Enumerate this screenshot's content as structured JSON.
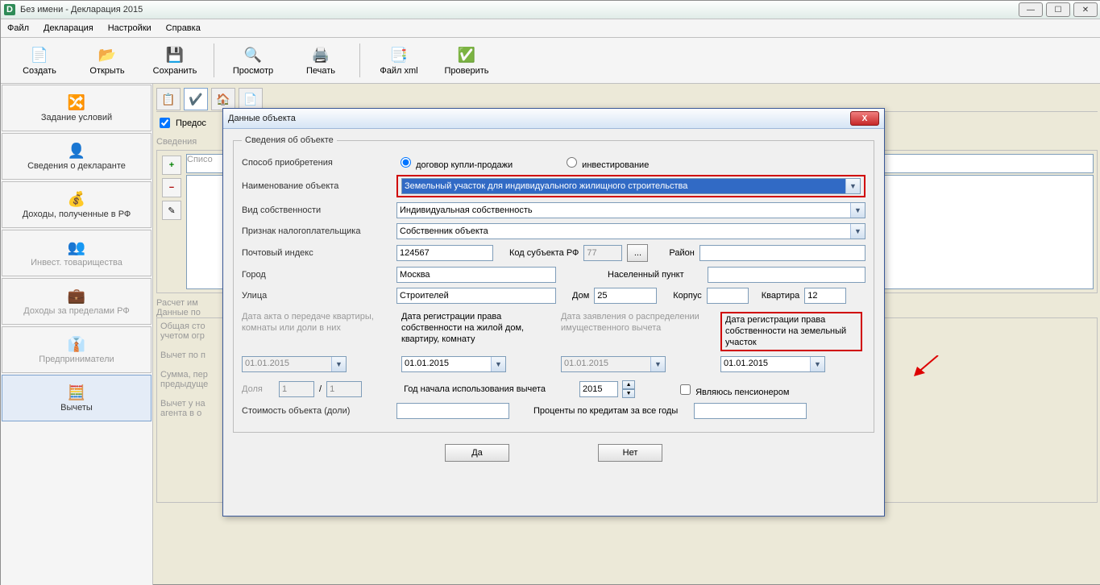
{
  "window": {
    "title": "Без имени - Декларация 2015"
  },
  "menu": {
    "file": "Файл",
    "declaration": "Декларация",
    "settings": "Настройки",
    "help": "Справка"
  },
  "toolbar": {
    "create": "Создать",
    "open": "Открыть",
    "save": "Сохранить",
    "preview": "Просмотр",
    "print": "Печать",
    "xml": "Файл xml",
    "check": "Проверить"
  },
  "sidebar": {
    "conditions": "Задание условий",
    "declarant": "Сведения о декларанте",
    "income_rf": "Доходы, полученные в РФ",
    "invest": "Инвест. товарищества",
    "income_abroad": "Доходы за пределами РФ",
    "entrepreneurs": "Предприниматели",
    "deductions": "Вычеты"
  },
  "mainbg": {
    "checkbox": "Предос",
    "heading": "Сведения",
    "list_btn": "Списо",
    "calc1": "Расчет им",
    "calc2": "Данные по",
    "line1": "Общая сто",
    "line2": "учетом огр",
    "line3": "Вычет по п",
    "line4": "Сумма, пер",
    "line5": "предыдуще",
    "line6": "Вычет у на",
    "line7": "агента в о"
  },
  "dialog": {
    "title": "Данные объекта",
    "legend": "Сведения об объекте",
    "labels": {
      "acq_method": "Способ приобретения",
      "radio_buy": "договор купли-продажи",
      "radio_invest": "инвестирование",
      "object_name": "Наименование объекта",
      "ownership": "Вид собственности",
      "taxpayer": "Признак налогоплательщика",
      "postcode": "Почтовый индекс",
      "region_code": "Код субъекта РФ",
      "district": "Район",
      "city": "Город",
      "settlement": "Населенный пункт",
      "street": "Улица",
      "house": "Дом",
      "building": "Корпус",
      "flat": "Квартира",
      "date_act": "Дата акта о передаче квартиры, комнаты или доли в них",
      "date_reg_house": "Дата регистрации права собственности на жилой дом, квартиру, комнату",
      "date_statement": "Дата заявления о распределении имущественного вычета",
      "date_reg_land": "Дата регистрации права собственности на земельный участок",
      "share": "Доля",
      "year_start": "Год начала использования вычета",
      "pensioner": "Являюсь пенсионером",
      "cost": "Стоимость объекта (доли)",
      "interest": "Проценты по кредитам за все годы",
      "ok": "Да",
      "cancel": "Нет"
    },
    "values": {
      "object_name": "Земельный участок для индивидуального жилищного строительства",
      "ownership": "Индивидуальная собственность",
      "taxpayer": "Собственник объекта",
      "postcode": "124567",
      "region_code": "77",
      "city": "Москва",
      "street": "Строителей",
      "house": "25",
      "flat": "12",
      "date": "01.01.2015",
      "share_num": "1",
      "share_den": "1",
      "year": "2015",
      "dots": "..."
    }
  }
}
